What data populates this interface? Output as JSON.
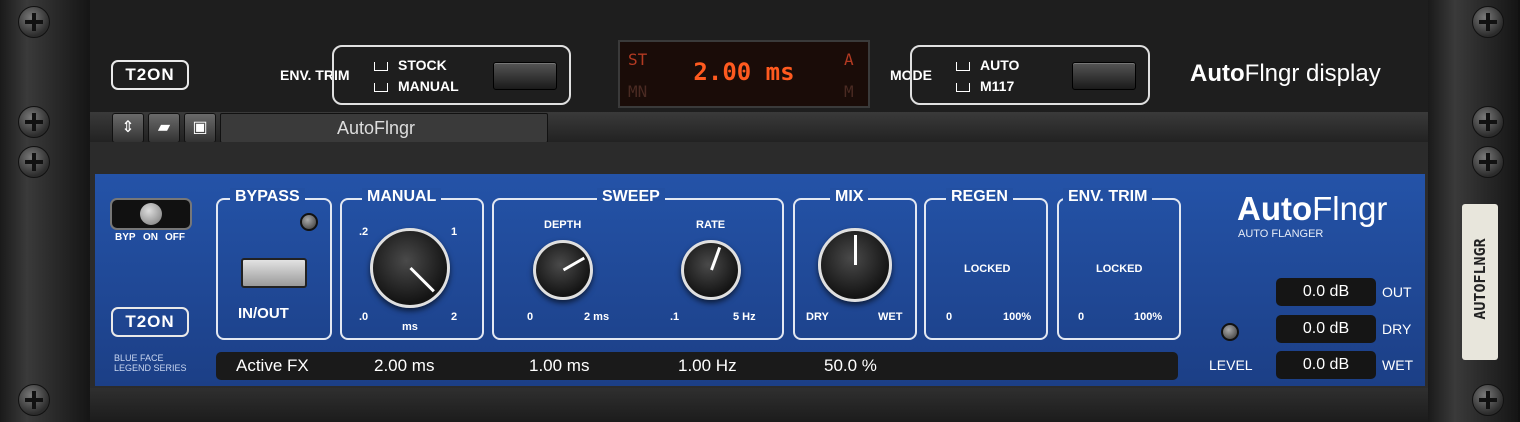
{
  "top_unit": {
    "logo": "T2ON",
    "env_trim": {
      "label": "ENV. TRIM",
      "options": [
        "STOCK",
        "MANUAL"
      ]
    },
    "display": {
      "value": "2.00 ms",
      "top_left": "ST",
      "bottom_left": "MN",
      "top_right": "A",
      "bottom_right": "M"
    },
    "mode": {
      "label": "MODE",
      "options": [
        "AUTO",
        "M117"
      ]
    },
    "title_bold": "Auto",
    "title_rest": "Flngr display"
  },
  "toolbar": {
    "preset_name": "AutoFlngr"
  },
  "bottom_unit": {
    "power_switch": {
      "byp": "BYP",
      "on": "ON",
      "off": "OFF"
    },
    "logo": "T2ON",
    "series_line1": "BLUE FACE",
    "series_line2": "LEGEND SERIES",
    "bypass": {
      "title": "BYPASS",
      "button_label": "IN/OUT"
    },
    "manual": {
      "title": "MANUAL",
      "tick_top_left": ".2",
      "tick_top_right": "1",
      "tick_bottom_left": ".0",
      "tick_bottom_right": "2",
      "unit": "ms"
    },
    "sweep": {
      "title": "SWEEP",
      "depth": {
        "label": "DEPTH",
        "min": "0",
        "max": "2 ms"
      },
      "rate": {
        "label": "RATE",
        "min": ".1",
        "max": "5 Hz"
      }
    },
    "mix": {
      "title": "MIX",
      "min": "DRY",
      "max": "WET"
    },
    "regen": {
      "title": "REGEN",
      "state": "LOCKED",
      "min": "0",
      "max": "100%"
    },
    "env_trim": {
      "title": "ENV. TRIM",
      "state": "LOCKED",
      "min": "0",
      "max": "100%"
    },
    "brand_bold": "Auto",
    "brand_rest": "Flngr",
    "brand_sub": "AUTO FLANGER",
    "status": {
      "label": "Active FX",
      "manual": "2.00 ms",
      "depth": "1.00 ms",
      "rate": "1.00 Hz",
      "mix": "50.0 %"
    },
    "meters": [
      {
        "value": "0.0 dB",
        "label": "OUT"
      },
      {
        "value": "0.0 dB",
        "label": "DRY"
      },
      {
        "value": "0.0 dB",
        "label": "WET"
      }
    ],
    "level_label": "LEVEL"
  },
  "side_tape": "AUTOFLNGR",
  "colors": {
    "panel_blue": "#2350a2",
    "lcd_text": "#ff5a1f"
  }
}
